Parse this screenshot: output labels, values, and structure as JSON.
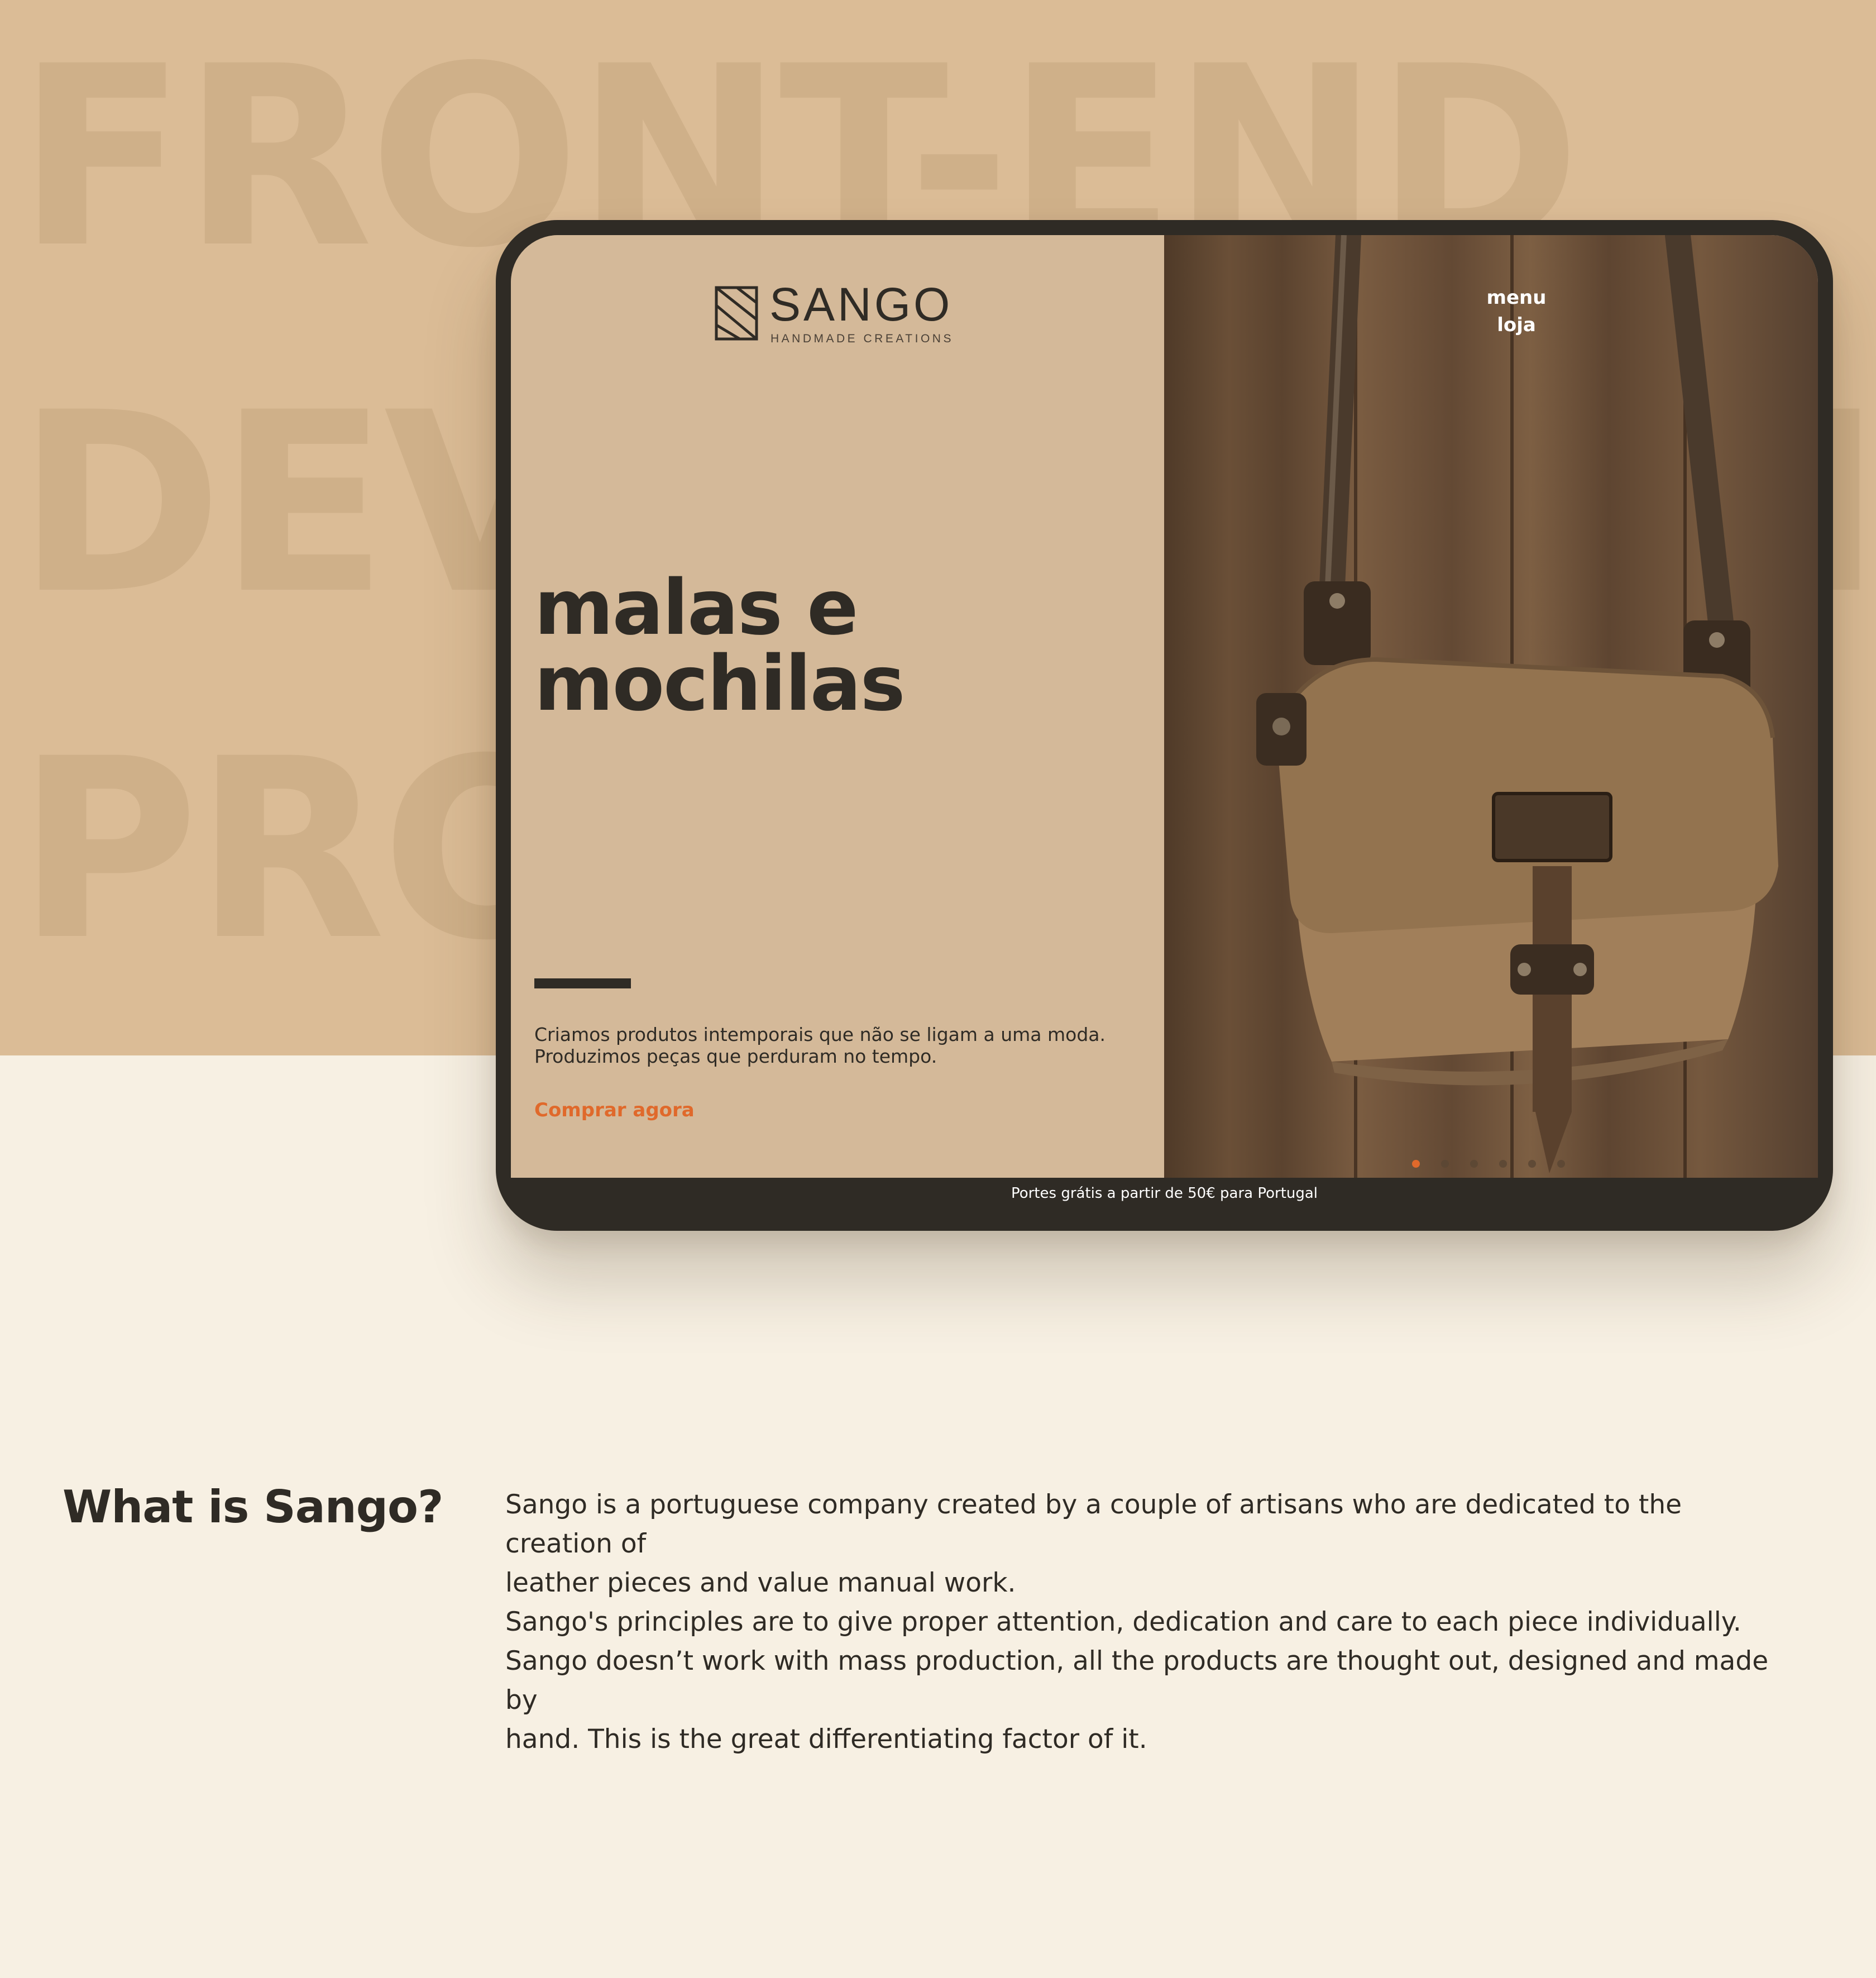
{
  "background": {
    "words": [
      "FRONT-END",
      "DEVELOPMENT",
      "PROJECT"
    ],
    "colors": {
      "top_band": "#dbbc96",
      "page": "#f7f0e3",
      "word": "#cfb089"
    }
  },
  "device": {
    "logo": {
      "icon": "sango-square-logo-icon",
      "name": "SANGO",
      "tagline": "HANDMADE CREATIONS"
    },
    "nav": {
      "items": [
        "menu",
        "loja"
      ]
    },
    "hero": {
      "title_lines": [
        "malas e",
        "mochilas"
      ],
      "description_lines": [
        "Criamos produtos intemporais que não se ligam a uma moda.",
        "Produzimos peças que perduram no tempo."
      ],
      "cta": "Comprar agora"
    },
    "image": {
      "icon": "leather-bag-image",
      "subject": "leather shoulder bag on wooden planks"
    },
    "carousel": {
      "count": 6,
      "active_index": 0
    },
    "status_bar": "Portes grátis a partir de 50€ para Portugal",
    "colors": {
      "frame": "#2f2b25",
      "panel": "#d4b999",
      "accent": "#e0692b"
    }
  },
  "about": {
    "heading": "What is Sango?",
    "lines": [
      "Sango is a portuguese company created by a couple of artisans who are dedicated to the creation of",
      "leather pieces and value manual work.",
      "Sango's principles are to give proper attention, dedication and care to each piece individually.",
      "Sango doesn’t work with mass production, all the products are thought out, designed and made by",
      "hand. This is the great differentiating factor of it."
    ]
  }
}
